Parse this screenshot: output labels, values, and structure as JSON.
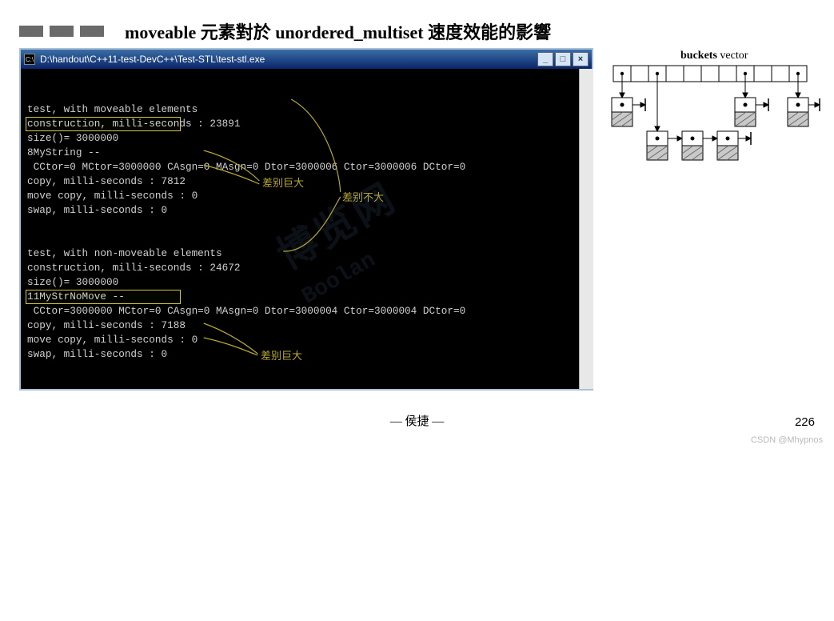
{
  "header": {
    "title": "moveable 元素對於 unordered_multiset 速度效能的影響"
  },
  "window": {
    "title_path": "D:\\handout\\C++11-test-DevC++\\Test-STL\\test-stl.exe",
    "icon_glyph": "C:\\",
    "buttons": {
      "min": "_",
      "max": "□",
      "close": "×"
    }
  },
  "term": {
    "l0": "",
    "l1": "test, with moveable elements",
    "l2": "construction, milli-seconds : 23891",
    "l3": "size()= 3000000",
    "l4": "8MyString --",
    "l5": " CCtor=0 MCtor=3000000 CAsgn=0 MAsgn=0 Dtor=3000006 Ctor=3000006 DCtor=0",
    "l6": "copy, milli-seconds : 7812",
    "l7": "move copy, milli-seconds : 0",
    "l8": "swap, milli-seconds : 0",
    "l9": "",
    "l10": "",
    "l11": "test, with non-moveable elements",
    "l12": "construction, milli-seconds : 24672",
    "l13": "size()= 3000000",
    "l14": "11MyStrNoMove --",
    "l15": " CCtor=3000000 MCtor=0 CAsgn=0 MAsgn=0 Dtor=3000004 Ctor=3000004 DCtor=0",
    "l16": "copy, milli-seconds : 7188",
    "l17": "move copy, milli-seconds : 0",
    "l18": "swap, milli-seconds : 0"
  },
  "annot": {
    "a1": "差别巨大",
    "a2": "差别不大",
    "a3": "差别巨大"
  },
  "diagram": {
    "label_bold": "buckets",
    "label_rest": " vector"
  },
  "footer": {
    "center": "— 侯捷 —",
    "page": "226"
  },
  "watermark_bottom": "CSDN @Mhypnos",
  "watermark_mid": {
    "a": "博览网",
    "b": "Boolan"
  }
}
